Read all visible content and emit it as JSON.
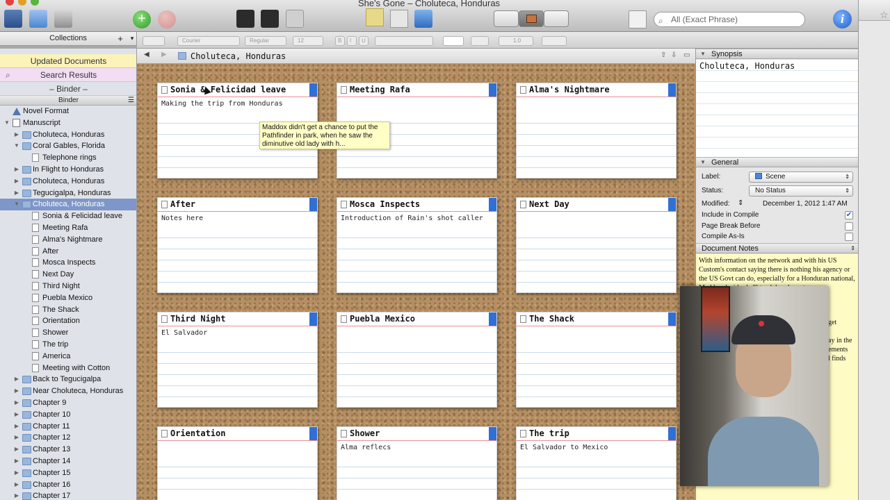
{
  "window": {
    "title": "She's Gone – Choluteca, Honduras"
  },
  "toolbar": {
    "search_placeholder": "All (Exact Phrase)",
    "info_label": "i"
  },
  "collections": {
    "header": "Collections",
    "add": "+",
    "caret": "▾"
  },
  "formatbar": {
    "font": "Courier",
    "style": "Regular",
    "size": "12",
    "bold": "B",
    "italic": "I",
    "underline": "U",
    "spacing": "1.0"
  },
  "sidebar": {
    "updated_tab": "Updated Documents",
    "search_tab": "Search Results",
    "binder_tab": "– Binder –",
    "binder_header": "Binder",
    "items": [
      {
        "label": "Novel Format",
        "indent": 0,
        "type": "warn",
        "tri": ""
      },
      {
        "label": "Manuscript",
        "indent": 0,
        "type": "manu",
        "tri": "▼"
      },
      {
        "label": "Choluteca, Honduras",
        "indent": 1,
        "type": "folder",
        "tri": "▶"
      },
      {
        "label": "Coral Gables, Florida",
        "indent": 1,
        "type": "folder",
        "tri": "▼"
      },
      {
        "label": "Telephone rings",
        "indent": 2,
        "type": "doc",
        "tri": ""
      },
      {
        "label": "In Flight to Honduras",
        "indent": 1,
        "type": "folder",
        "tri": "▶"
      },
      {
        "label": "Choluteca, Honduras",
        "indent": 1,
        "type": "folder",
        "tri": "▶"
      },
      {
        "label": "Tegucigalpa, Honduras",
        "indent": 1,
        "type": "folder",
        "tri": "▶"
      },
      {
        "label": "Choluteca, Honduras",
        "indent": 1,
        "type": "folder",
        "tri": "▼",
        "selected": true
      },
      {
        "label": "Sonia & Felicidad leave",
        "indent": 2,
        "type": "doc",
        "tri": ""
      },
      {
        "label": "Meeting Rafa",
        "indent": 2,
        "type": "doc",
        "tri": ""
      },
      {
        "label": "Alma's Nightmare",
        "indent": 2,
        "type": "doc",
        "tri": ""
      },
      {
        "label": "After",
        "indent": 2,
        "type": "doc",
        "tri": ""
      },
      {
        "label": "Mosca Inspects",
        "indent": 2,
        "type": "doc",
        "tri": ""
      },
      {
        "label": "Next Day",
        "indent": 2,
        "type": "doc",
        "tri": ""
      },
      {
        "label": "Third Night",
        "indent": 2,
        "type": "doc",
        "tri": ""
      },
      {
        "label": "Puebla Mexico",
        "indent": 2,
        "type": "doc",
        "tri": ""
      },
      {
        "label": "The Shack",
        "indent": 2,
        "type": "doc",
        "tri": ""
      },
      {
        "label": "Orientation",
        "indent": 2,
        "type": "doc",
        "tri": ""
      },
      {
        "label": "Shower",
        "indent": 2,
        "type": "doc",
        "tri": ""
      },
      {
        "label": "The trip",
        "indent": 2,
        "type": "doc",
        "tri": ""
      },
      {
        "label": "America",
        "indent": 2,
        "type": "doc",
        "tri": ""
      },
      {
        "label": "Meeting with Cotton",
        "indent": 2,
        "type": "doc",
        "tri": ""
      },
      {
        "label": "Back to Tegucigalpa",
        "indent": 1,
        "type": "folder",
        "tri": "▶"
      },
      {
        "label": "Near Choluteca, Honduras",
        "indent": 1,
        "type": "folder",
        "tri": "▶"
      },
      {
        "label": "Chapter 9",
        "indent": 1,
        "type": "folder",
        "tri": "▶"
      },
      {
        "label": "Chapter 10",
        "indent": 1,
        "type": "folder",
        "tri": "▶"
      },
      {
        "label": "Chapter 11",
        "indent": 1,
        "type": "folder",
        "tri": "▶"
      },
      {
        "label": "Chapter 12",
        "indent": 1,
        "type": "folder",
        "tri": "▶"
      },
      {
        "label": "Chapter 13",
        "indent": 1,
        "type": "folder",
        "tri": "▶"
      },
      {
        "label": "Chapter 14",
        "indent": 1,
        "type": "folder",
        "tri": "▶"
      },
      {
        "label": "Chapter 15",
        "indent": 1,
        "type": "folder",
        "tri": "▶"
      },
      {
        "label": "Chapter 16",
        "indent": 1,
        "type": "folder",
        "tri": "▶"
      },
      {
        "label": "Chapter 17",
        "indent": 1,
        "type": "folder",
        "tri": "▶"
      }
    ]
  },
  "pathbar": {
    "title": "Choluteca, Honduras"
  },
  "corkboard": {
    "cards": [
      {
        "title": "Sonia & Felicidad leave",
        "synopsis": "Making the trip from Honduras"
      },
      {
        "title": "Meeting Rafa",
        "synopsis": ""
      },
      {
        "title": "Alma's Nightmare",
        "synopsis": ""
      },
      {
        "title": "After",
        "synopsis": "Notes here"
      },
      {
        "title": "Mosca Inspects",
        "synopsis": "Introduction of Rain's shot caller"
      },
      {
        "title": "Next Day",
        "synopsis": ""
      },
      {
        "title": "Third Night",
        "synopsis": "El Salvador"
      },
      {
        "title": "Puebla Mexico",
        "synopsis": ""
      },
      {
        "title": "The Shack",
        "synopsis": ""
      },
      {
        "title": "Orientation",
        "synopsis": ""
      },
      {
        "title": "Shower",
        "synopsis": "Alma reflecs"
      },
      {
        "title": "The trip",
        "synopsis": "El Salvador to Mexico"
      }
    ],
    "tooltip": "Maddox didn't get a chance to put the Pathfinder in park, when he saw the diminutive old lady with h..."
  },
  "inspector": {
    "synopsis_header": "Synopsis",
    "synopsis_text": "Choluteca, Honduras",
    "general_header": "General",
    "label_caption": "Label:",
    "label_value": "Scene",
    "status_caption": "Status:",
    "status_value": "No Status",
    "modified_caption": "Modified:",
    "modified_value": "December 1, 2012 1:47 AM",
    "include_compile": "Include in Compile",
    "page_break": "Page Break Before",
    "compile_as_is": "Compile As-Is",
    "notes_header": "Document Notes",
    "notes_text": "With information on the network and with his US Custom's contact saying there is nothing his agency or the US Govt can do, especially for a Honduran national, Maddox decides he'll track her down to",
    "notes_fragment": "get\n\nay in the\nements\nl finds"
  },
  "colors": {
    "card_flag": "#2f6fd6",
    "selected_row": "#7f97c8",
    "updated_tab": "#fbf3b8",
    "search_tab": "#f2ddf3",
    "notes_bg": "#fffbc4"
  }
}
